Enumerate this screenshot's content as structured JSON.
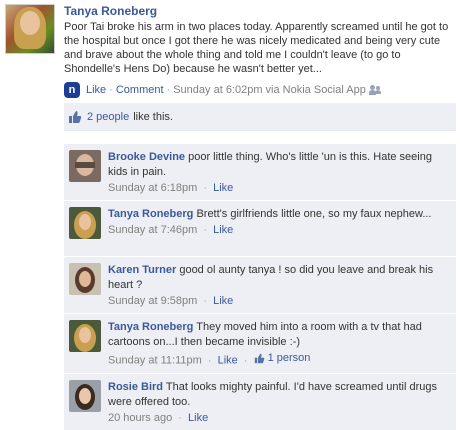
{
  "post": {
    "author": "Tanya Roneberg",
    "text": "Poor Tai broke his arm in two places today. Apparently screamed until he got to the hospital but once I got there he was nicely medicated and being very cute and brave about the whole thing and told me I couldn't leave (to go to Shondelle's Hens Do) because he wasn't better yet...",
    "app_icon_letter": "n",
    "like_label": "Like",
    "comment_label": "Comment",
    "timestamp": "Sunday at 6:02pm via Nokia Social App"
  },
  "likes": {
    "count_link": "2 people",
    "suffix": "like this."
  },
  "comments": [
    {
      "author": "Brooke Devine",
      "text": "poor little thing. Who's little 'un is this. Hate seeing kids in pain.",
      "timestamp": "Sunday at 6:18pm",
      "like_label": "Like",
      "avatar_color": "#8c7a6e"
    },
    {
      "author": "Tanya Roneberg",
      "text": "Brett's girlfriends little one, so my faux nephew...",
      "timestamp": "Sunday at 7:46pm",
      "like_label": "Like",
      "avatar_color": "#b89050"
    },
    {
      "author": "Karen Turner",
      "text": "good ol aunty tanya ! so did you leave and break his heart ?",
      "timestamp": "Sunday at 9:58pm",
      "like_label": "Like",
      "avatar_color": "#6e5040"
    },
    {
      "author": "Tanya Roneberg",
      "text": "They moved him into a room with a tv that had cartoons on...I then became invisible :-)",
      "timestamp": "Sunday at 11:11pm",
      "like_label": "Like",
      "like_count": "1 person",
      "avatar_color": "#b89050"
    },
    {
      "author": "Rosie Bird",
      "text": "That looks mighty painful. I'd have screamed until drugs were offered too.",
      "timestamp": "20 hours ago",
      "like_label": "Like",
      "avatar_color": "#a09080"
    }
  ],
  "colors": {
    "link": "#3b5998",
    "comment_bg": "#edeff4",
    "meta": "#808080"
  }
}
